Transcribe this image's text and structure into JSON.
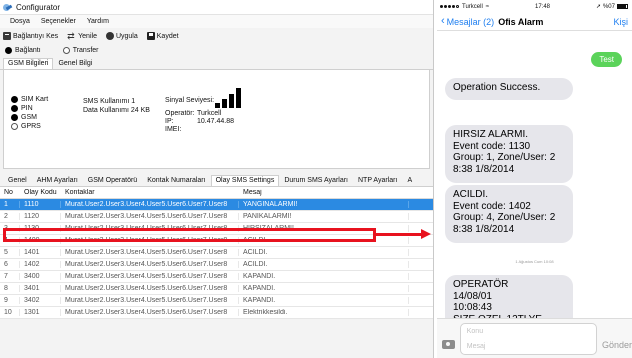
{
  "configurator": {
    "window_title": "Configurator",
    "menu": [
      "Dosya",
      "Seçenekler",
      "Yardım"
    ],
    "toolbar": {
      "connect_label": "Bağlantıyı Kes",
      "refresh_label": "Yenile",
      "apply_label": "Uygula",
      "save_label": "Kaydet"
    },
    "connection_modes": [
      {
        "label": "Bağlantı",
        "selected": true
      },
      {
        "label": "Transfer",
        "selected": false
      }
    ],
    "info_tabs": [
      "GSM Bilgileri",
      "Genel Bilgi"
    ],
    "status_items": [
      {
        "label": "SIM Kart",
        "on": true
      },
      {
        "label": "PIN",
        "on": true
      },
      {
        "label": "GSM",
        "on": true
      },
      {
        "label": "GPRS",
        "on": false
      }
    ],
    "sms_used_text": "SMS Kullanımı  1",
    "data_used_text": "Data Kullanımı  24 KB",
    "signal_label": "Sinyal Seviyesi:",
    "signal_level_bars": 4,
    "operator_label": "Operatör:",
    "operator_value": "Turkcell",
    "ip_label": "IP:",
    "ip_value": "10.47.44.88",
    "imei_label": "IMEI:",
    "imei_value": "",
    "settings_tabs": [
      "Genel",
      "AHM Ayarları",
      "GSM Operatörü",
      "Kontak Numaraları",
      "Olay SMS Settings",
      "Durum SMS Ayarları",
      "NTP Ayarları",
      "A"
    ],
    "active_settings_tab": "Olay SMS Settings",
    "table": {
      "columns": [
        "No",
        "Olay Kodu",
        "Kontaklar",
        "Mesaj"
      ],
      "rows": [
        {
          "no": "1",
          "code": "1110",
          "contacts": "Murat.User2.User3.User4.User5.User6.User7.User8",
          "message": "YANGINALARMI!"
        },
        {
          "no": "2",
          "code": "1120",
          "contacts": "Murat.User2.User3.User4.User5.User6.User7.User8",
          "message": "PANIKALARMI!"
        },
        {
          "no": "3",
          "code": "1130",
          "contacts": "Murat.User2.User3.User4.User5.User6.User7.User8",
          "message": "HIRSIZALARMI!"
        },
        {
          "no": "4",
          "code": "1400",
          "contacts": "Murat.User2.User3.User4.User5.User6.User7.User8",
          "message": "ACILDI."
        },
        {
          "no": "5",
          "code": "1401",
          "contacts": "Murat.User2.User3.User4.User5.User6.User7.User8",
          "message": "ACILDI."
        },
        {
          "no": "6",
          "code": "1402",
          "contacts": "Murat.User2.User3.User4.User5.User6.User7.User8",
          "message": "ACILDI."
        },
        {
          "no": "7",
          "code": "3400",
          "contacts": "Murat.User2.User3.User4.User5.User6.User7.User8",
          "message": "KAPANDI."
        },
        {
          "no": "8",
          "code": "3401",
          "contacts": "Murat.User2.User3.User4.User5.User6.User7.User8",
          "message": "KAPANDI."
        },
        {
          "no": "9",
          "code": "3402",
          "contacts": "Murat.User2.User3.User4.User5.User6.User7.User8",
          "message": "KAPANDI."
        },
        {
          "no": "10",
          "code": "1301",
          "contacts": "Murat.User2.User3.User4.User5.User6.User7.User8",
          "message": "Elektrikkesildi."
        }
      ],
      "selected_row": 1,
      "highlighted_row": 3
    },
    "highlight_color": "#e8121e",
    "selection_color": "#2b8ae2"
  },
  "phone": {
    "carrier": "Turkcell",
    "time": "17:48",
    "battery": "%07",
    "back_label": "Mesajlar (2)",
    "contact_name": "Ofis Alarm",
    "details_label": "Kişi",
    "outgoing": "Test",
    "messages": [
      "Operation Success.",
      "HIRSIZ ALARMI.\nEvent code: 1130\nGroup: 1, Zone/User: 2\n8:38 1/8/2014",
      "ACILDI.\nEvent code: 1402\nGroup: 4, Zone/User: 2\n8:38 1/8/2014",
      "OPERATÖR\n14/08/01\n10:08:43\nSIZE OZEL 12TLYE HER"
    ],
    "timestamps": [
      "1 Ağustos Cum 08:38",
      "1 Ağustos Cum 10:08"
    ],
    "subject_placeholder": "Konu",
    "message_placeholder": "Mesaj",
    "send_label": "Gönder",
    "accent_color": "#1f7ff0",
    "bubble_out_color": "#5bd35a",
    "bubble_in_color": "#e6e6eb"
  }
}
